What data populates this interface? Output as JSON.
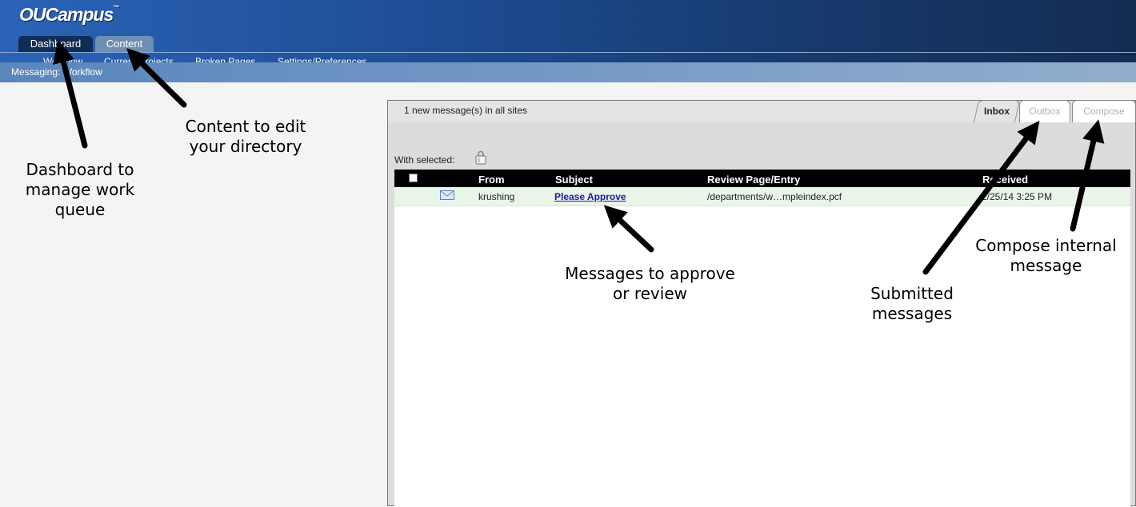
{
  "header": {
    "logo": "OUCampus",
    "logo_tm": "™",
    "tabs": [
      {
        "label": "Dashboard",
        "active": true
      },
      {
        "label": "Content",
        "active": false
      }
    ],
    "subnav": [
      "Workflow",
      "Current Projects",
      "Broken Pages",
      "Settings/Preferences"
    ],
    "breadcrumb": "Messaging: Workflow"
  },
  "messages": {
    "new_count_text": "1 new message(s) in all sites",
    "tabs": [
      {
        "label": "Inbox",
        "active": true
      },
      {
        "label": "Outbox",
        "active": false
      },
      {
        "label": "Compose",
        "active": false
      }
    ],
    "with_selected": "With selected:",
    "columns": [
      "From",
      "Subject",
      "Review Page/Entry",
      "Received"
    ],
    "rows": [
      {
        "from": "krushing",
        "subject": "Please Approve",
        "review_page": "/departments/w…mpleindex.pcf",
        "received": "2/25/14 3:25 PM"
      }
    ]
  },
  "annotations": {
    "dashboard": "Dashboard to manage work queue",
    "content": "Content to edit your directory",
    "messages": "Messages to approve or review",
    "submitted": "Submitted messages",
    "compose": "Compose internal message"
  },
  "colors": {
    "header_start": "#2b63b7",
    "header_end": "#142c52",
    "active_tab": "#0f2d56",
    "row_highlight": "#eaf5ea",
    "link": "#1a1aa6"
  },
  "icons": {
    "selected_action": "lock-icon",
    "message_status": "envelope-icon"
  }
}
